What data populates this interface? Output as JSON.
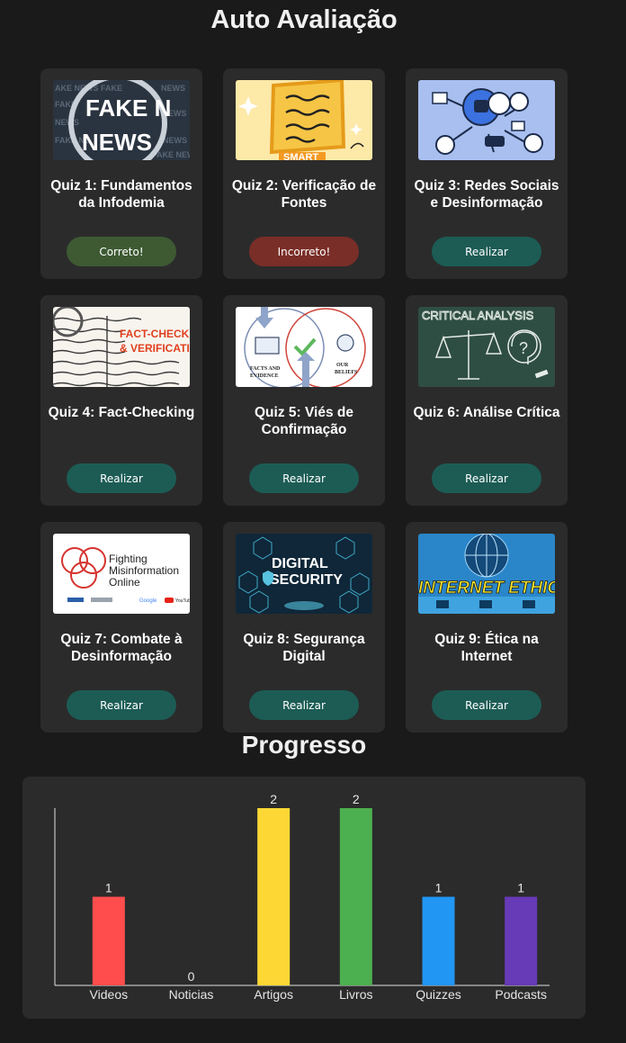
{
  "page": {
    "title": "Auto Avaliação"
  },
  "quizzes": [
    {
      "title": "Quiz 1: Fundamentos da Infodemia",
      "button": "Correto!",
      "status": "correct",
      "image_text": "FAKE NEWS"
    },
    {
      "title": "Quiz 2: Verificação de Fontes",
      "button": "Incorreto!",
      "status": "wrong",
      "image_text": "SMART"
    },
    {
      "title": "Quiz 3: Redes Sociais e Desinformação",
      "button": "Realizar",
      "status": "pending",
      "image_text": ""
    },
    {
      "title": "Quiz 4: Fact-Checking",
      "button": "Realizar",
      "status": "pending",
      "image_text": "FACT-CHECKING & VERIFICATION"
    },
    {
      "title": "Quiz 5: Viés de Confirmação",
      "button": "Realizar",
      "status": "pending",
      "image_text": "FACTS AND EVIDENCE / OUR BELIEFS"
    },
    {
      "title": "Quiz 6: Análise Crítica",
      "button": "Realizar",
      "status": "pending",
      "image_text": "CRITICAL ANALYSIS"
    },
    {
      "title": "Quiz 7: Combate à Desinformação",
      "button": "Realizar",
      "status": "pending",
      "image_text": "Fighting Misinformation Online"
    },
    {
      "title": "Quiz 8: Segurança Digital",
      "button": "Realizar",
      "status": "pending",
      "image_text": "DIGITAL SECURITY"
    },
    {
      "title": "Quiz 9: Ética na Internet",
      "button": "Realizar",
      "status": "pending",
      "image_text": "INTERNET ETHICS"
    }
  ],
  "progress": {
    "title": "Progresso"
  },
  "chart_data": {
    "type": "bar",
    "categories": [
      "Videos",
      "Noticias",
      "Artigos",
      "Livros",
      "Quizzes",
      "Podcasts"
    ],
    "values": [
      1,
      0,
      2,
      2,
      1,
      1
    ],
    "colors": [
      "#ff4d4d",
      "#ff8c3a",
      "#fdd835",
      "#4caf50",
      "#2196f3",
      "#673ab7"
    ],
    "ylim": [
      0,
      2
    ],
    "grid": false,
    "legend": "none",
    "data_labels": true
  },
  "colors": {
    "background": "#1a1a1a",
    "card": "#2b2b2b",
    "button_pending": "#1c5c55",
    "button_correct": "#3d5a33",
    "button_wrong": "#7a2e28"
  }
}
